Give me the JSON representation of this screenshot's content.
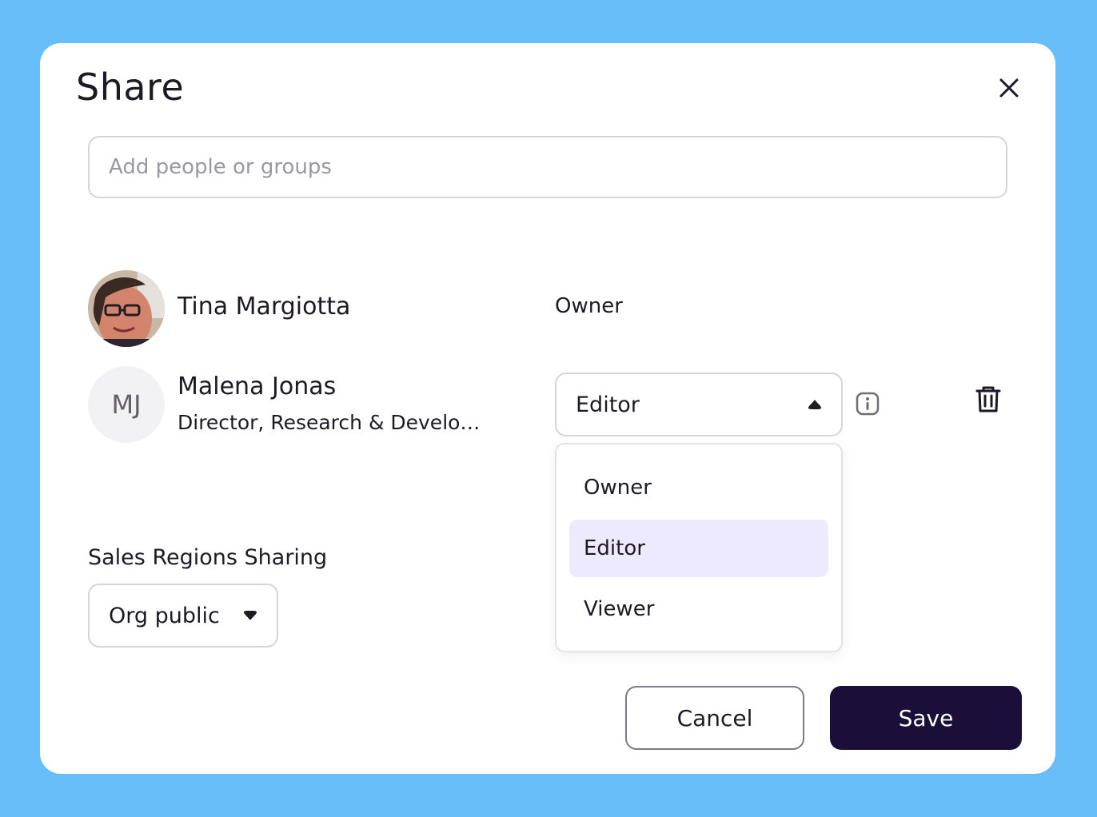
{
  "dialog": {
    "title": "Share",
    "close_icon": "close-icon"
  },
  "search": {
    "placeholder": "Add people or groups",
    "value": ""
  },
  "people": [
    {
      "name": "Tina Margiotta",
      "role": "Owner",
      "avatar": "photo"
    },
    {
      "name": "Malena Jonas",
      "title": "Director, Research & Develo…",
      "initials": "MJ",
      "role": "Editor",
      "role_icon": "caret-up-icon"
    }
  ],
  "role_menu": {
    "options": [
      "Owner",
      "Editor",
      "Viewer"
    ],
    "selected": "Editor"
  },
  "sales_regions": {
    "label": "Sales Regions Sharing",
    "value": "Org public"
  },
  "footer": {
    "cancel_label": "Cancel",
    "save_label": "Save"
  },
  "colors": {
    "backdrop": "#66bdf8",
    "primary": "#1b0f3a",
    "selected_option": "#eeeafd"
  }
}
